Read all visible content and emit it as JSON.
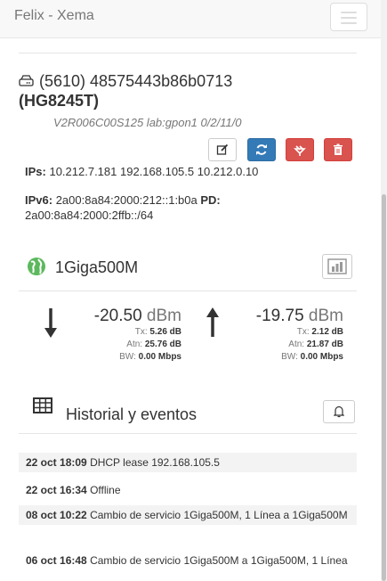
{
  "navbar": {
    "brand": "Felix - Xema"
  },
  "device": {
    "id_serial": "(5610) 48575443b86b0713",
    "model": "(HG8245T)",
    "firmware": "V2R006C00S125 lab:gpon1 0/2/11/0",
    "actions": [
      {
        "icon": "edit-icon",
        "style": "default"
      },
      {
        "icon": "refresh-icon",
        "style": "primary"
      },
      {
        "icon": "plug-icon",
        "style": "danger"
      },
      {
        "icon": "trash-icon",
        "style": "danger"
      }
    ],
    "ips_label": "IPs:",
    "ips_value": "10.212.7.181 192.168.105.5 10.212.0.10",
    "ipv6_label": "IPv6:",
    "ipv6_value": "2a00:8a84:2000:212::1:b0a",
    "pd_label": "PD:",
    "pd_value": "2a00:8a84:2000:2ffb::/64"
  },
  "service": {
    "icon": "globe-icon",
    "name": "1Giga500M",
    "chart_button_icon": "bar-chart-icon",
    "down": {
      "icon": "arrow-down-icon",
      "power": "-20.50",
      "unit": "dBm",
      "tx_label": "Tx:",
      "tx": "5.26 dB",
      "atn_label": "Atn:",
      "atn": "25.76 dB",
      "bw_label": "BW:",
      "bw": "0.00 Mbps"
    },
    "up": {
      "icon": "arrow-up-icon",
      "power": "-19.75",
      "unit": "dBm",
      "tx_label": "Tx:",
      "tx": "2.12 dB",
      "atn_label": "Atn:",
      "atn": "21.87 dB",
      "bw_label": "BW:",
      "bw": "0.00 Mbps"
    }
  },
  "history": {
    "icon": "table-icon",
    "title": "Historial y eventos",
    "bell_icon": "bell-icon",
    "events": [
      {
        "time": "22 oct 18:09",
        "text": "DHCP lease 192.168.105.5"
      },
      {
        "time": "22 oct 16:34",
        "text": "Offline"
      },
      {
        "time": "08 oct 10:22",
        "text": "Cambio de servicio 1Giga500M, 1 Línea a 1Giga500M"
      },
      {
        "time": "06 oct 16:48",
        "text": "Cambio de servicio 1Giga500M a 1Giga500M, 1 Línea"
      }
    ]
  },
  "colors": {
    "primary": "#337ab7",
    "danger": "#d9534f",
    "success": "#5cb85c",
    "muted": "#777777"
  }
}
